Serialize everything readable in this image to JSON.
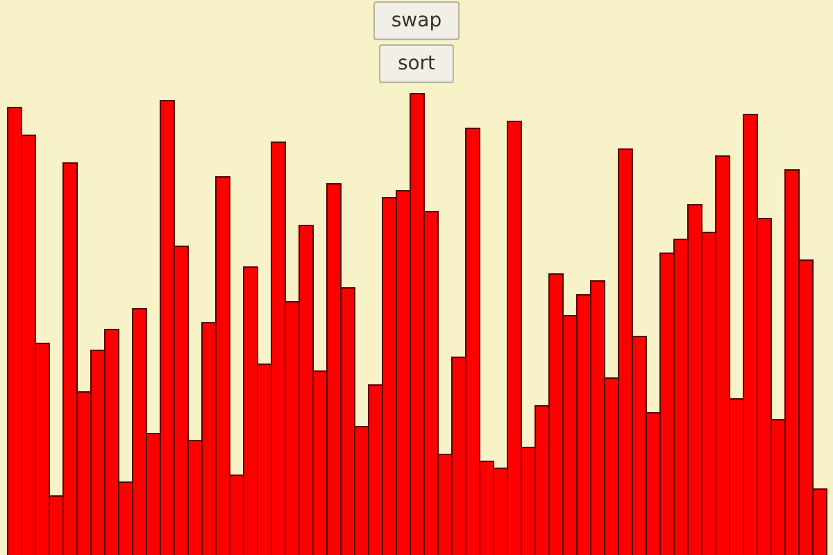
{
  "buttons": [
    {
      "label": "swap"
    },
    {
      "label": "sort"
    }
  ]
}
